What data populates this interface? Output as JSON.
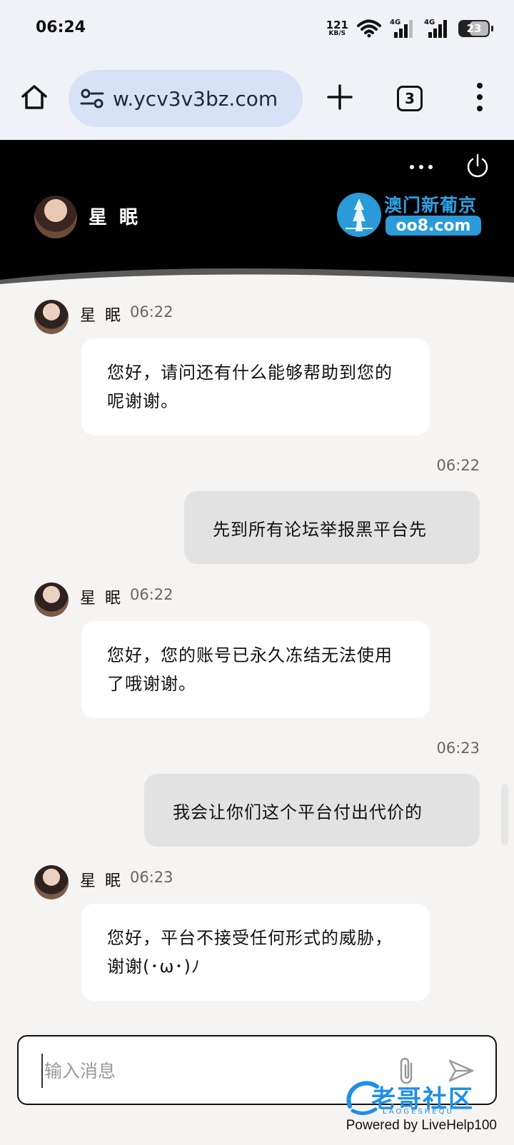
{
  "status_bar": {
    "time": "06:24",
    "net_speed_value": "121",
    "net_speed_unit": "KB/S",
    "network_label_1": "4G",
    "network_label_2": "4G",
    "battery": "23"
  },
  "browser": {
    "url": "w.ycv3v3bz.com",
    "tab_count": "3"
  },
  "chat_header": {
    "agent_name": "星 眠",
    "brand_name": "澳门新葡京",
    "brand_url": "oo8.com"
  },
  "messages": [
    {
      "sender": "agent",
      "name": "星 眠",
      "time": "06:22",
      "text": "您好，请问还有什么能够帮助到您的呢谢谢。"
    },
    {
      "sender": "user",
      "time": "06:22",
      "text": "先到所有论坛举报黑平台先"
    },
    {
      "sender": "agent",
      "name": "星 眠",
      "time": "06:22",
      "text": "您好，您的账号已永久冻结无法使用了哦谢谢。"
    },
    {
      "sender": "user",
      "time": "06:23",
      "text": "我会让你们这个平台付出代价的"
    },
    {
      "sender": "agent",
      "name": "星 眠",
      "time": "06:23",
      "text": "您好，平台不接受任何形式的威胁，谢谢(･ω･)ﾉ"
    }
  ],
  "composer": {
    "placeholder": "输入消息"
  },
  "footer": {
    "powered_by": "Powered by LiveHelp100",
    "watermark": "老哥社区",
    "watermark_sub": "LAOGESHEQU"
  }
}
